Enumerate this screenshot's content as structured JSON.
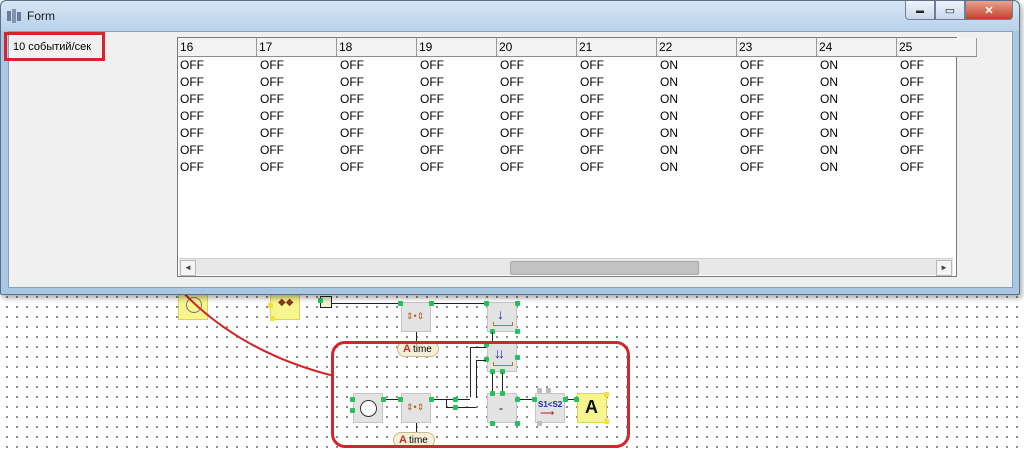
{
  "window": {
    "title": "Form",
    "rate_label": "10 событий/сек",
    "controls": {
      "minimize": "▬",
      "maximize": "▭",
      "close": "✕"
    }
  },
  "grid": {
    "columns": [
      "16",
      "17",
      "18",
      "19",
      "20",
      "21",
      "22",
      "23",
      "24",
      "25"
    ],
    "rows": [
      [
        "OFF",
        "OFF",
        "OFF",
        "OFF",
        "OFF",
        "OFF",
        "ON",
        "OFF",
        "ON",
        "OFF"
      ],
      [
        "OFF",
        "OFF",
        "OFF",
        "OFF",
        "OFF",
        "OFF",
        "ON",
        "OFF",
        "ON",
        "OFF"
      ],
      [
        "OFF",
        "OFF",
        "OFF",
        "OFF",
        "OFF",
        "OFF",
        "ON",
        "OFF",
        "ON",
        "OFF"
      ],
      [
        "OFF",
        "OFF",
        "OFF",
        "OFF",
        "OFF",
        "OFF",
        "ON",
        "OFF",
        "ON",
        "OFF"
      ],
      [
        "OFF",
        "OFF",
        "OFF",
        "OFF",
        "OFF",
        "OFF",
        "ON",
        "OFF",
        "ON",
        "OFF"
      ],
      [
        "OFF",
        "OFF",
        "OFF",
        "OFF",
        "OFF",
        "OFF",
        "ON",
        "OFF",
        "ON",
        "OFF"
      ],
      [
        "OFF",
        "OFF",
        "OFF",
        "OFF",
        "OFF",
        "OFF",
        "ON",
        "OFF",
        "ON",
        "OFF"
      ]
    ],
    "scroll_left": "◄",
    "scroll_right": "►"
  },
  "diagram": {
    "time_label_text": "time",
    "time_label_icon": "A",
    "subtract_label": "-",
    "compare_label": "S1<S2",
    "output_label": "A",
    "icons": [
      "timer-icon",
      "clock-icon",
      "swap-icon",
      "download-arrow-icon",
      "double-download-icon",
      "text-output-icon"
    ],
    "highlight_color": "#d7232c",
    "pin_color": "#22c35a"
  }
}
